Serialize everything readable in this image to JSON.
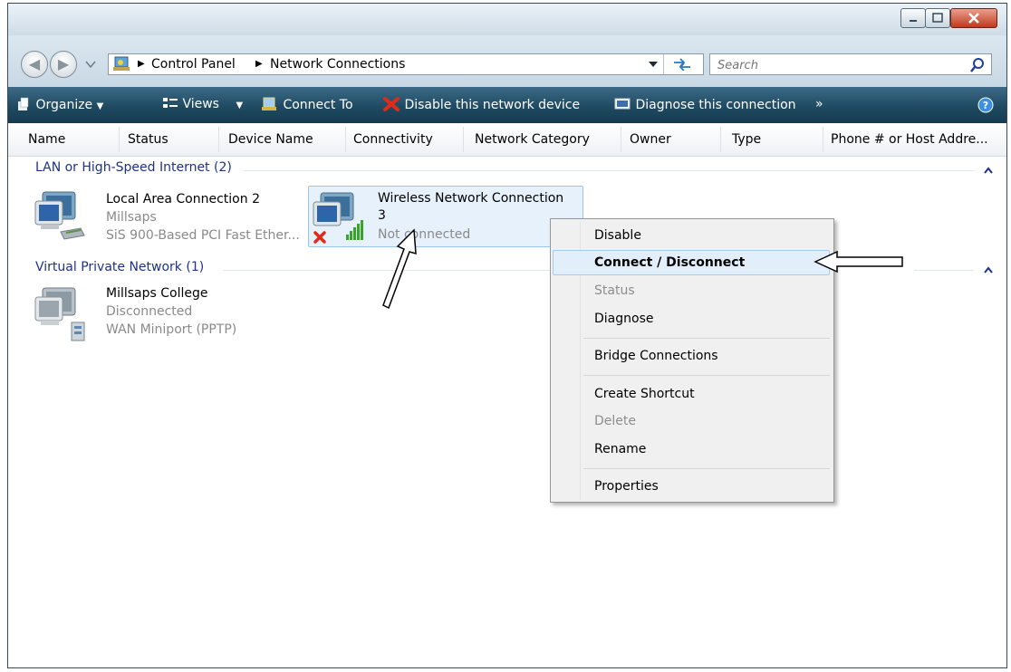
{
  "window": {
    "address": {
      "root": "Control Panel",
      "current": "Network Connections"
    },
    "search_placeholder": "Search"
  },
  "toolbar": {
    "organize": "Organize",
    "views": "Views",
    "connect_to": "Connect To",
    "disable": "Disable this network device",
    "diagnose": "Diagnose this connection",
    "more": "»"
  },
  "columns": [
    "Name",
    "Status",
    "Device Name",
    "Connectivity",
    "Network Category",
    "Owner",
    "Type",
    "Phone # or Host Addre..."
  ],
  "groups": {
    "lan": {
      "title": "LAN or High-Speed Internet (2)",
      "items": [
        {
          "name": "Local Area Connection 2",
          "status": "Millsaps",
          "device": "SiS 900-Based PCI Fast Ether..."
        },
        {
          "name_line1": "Wireless Network Connection",
          "name_line2": "3",
          "status": "Not connected"
        }
      ]
    },
    "vpn": {
      "title": "Virtual Private Network (1)",
      "items": [
        {
          "name": "Millsaps College",
          "status": "Disconnected",
          "device": "WAN Miniport (PPTP)"
        }
      ]
    }
  },
  "context_menu": {
    "disable": "Disable",
    "connect": "Connect / Disconnect",
    "status": "Status",
    "diagnose": "Diagnose",
    "bridge": "Bridge Connections",
    "shortcut": "Create Shortcut",
    "delete": "Delete",
    "rename": "Rename",
    "properties": "Properties"
  },
  "colors": {
    "command_bar": "#1f4a62",
    "group_text": "#1e3287",
    "selection": "#dcebfc"
  }
}
